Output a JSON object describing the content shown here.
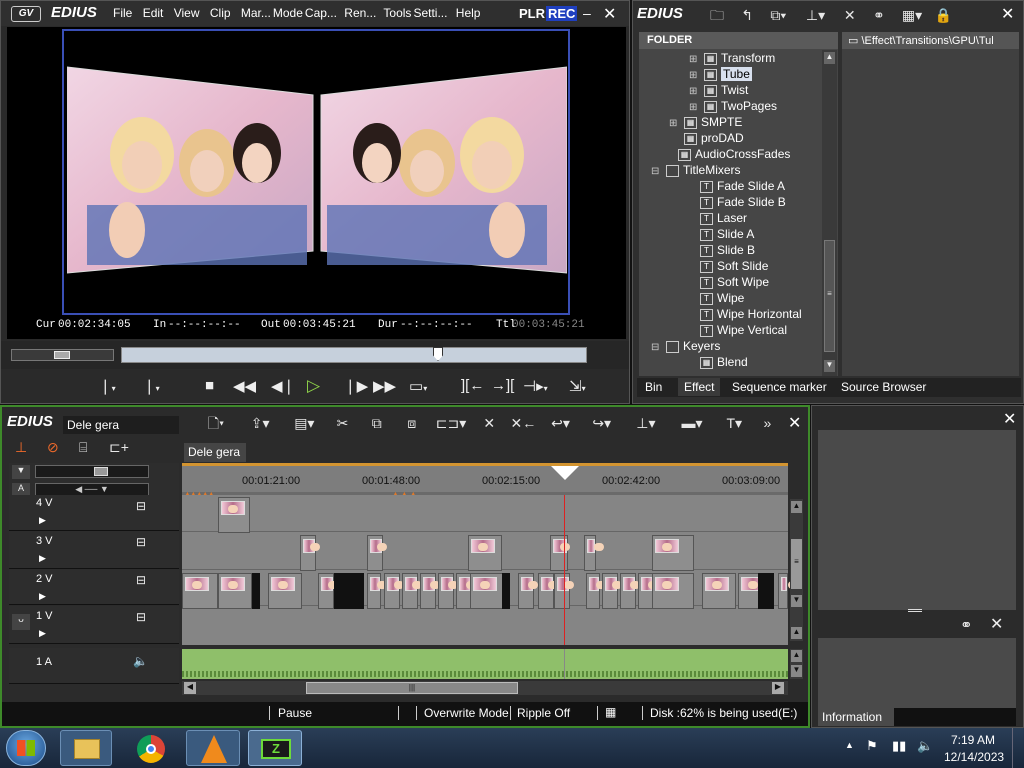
{
  "player": {
    "brand": "EDIUS",
    "menu": [
      "File",
      "Edit",
      "View",
      "Clip",
      "Mar...",
      "Mode",
      "Cap...",
      "Ren...",
      "Tools",
      "Setti...",
      "Help"
    ],
    "plr": "PLR",
    "rec": "REC",
    "cur_label": "Cur",
    "cur_value": "00:02:34:05",
    "in_label": "In",
    "in_value": "--:--:--:--",
    "out_label": "Out",
    "out_value": "00:03:45:21",
    "dur_label": "Dur",
    "dur_value": "--:--:--:--",
    "ttl_label": "Ttl",
    "ttl_value": "00:03:45:21"
  },
  "effect_panel": {
    "brand": "EDIUS",
    "folder_header": "FOLDER",
    "path": "\\Effect\\Transitions\\GPU\\Tul",
    "tree": [
      {
        "label": "Transform",
        "expand": "+"
      },
      {
        "label": "Tube",
        "expand": "+",
        "selected": true
      },
      {
        "label": "Twist",
        "expand": "+"
      },
      {
        "label": "TwoPages",
        "expand": "+"
      },
      {
        "label": "SMPTE",
        "expand": "+"
      },
      {
        "label": "proDAD",
        "expand": ""
      },
      {
        "label": "AudioCrossFades",
        "expand": ""
      },
      {
        "label": "TitleMixers",
        "expand": "−"
      },
      {
        "label": "Fade Slide A",
        "expand": ""
      },
      {
        "label": "Fade Slide B",
        "expand": ""
      },
      {
        "label": "Laser",
        "expand": ""
      },
      {
        "label": "Slide A",
        "expand": ""
      },
      {
        "label": "Slide B",
        "expand": ""
      },
      {
        "label": "Soft Slide",
        "expand": ""
      },
      {
        "label": "Soft Wipe",
        "expand": ""
      },
      {
        "label": "Wipe",
        "expand": ""
      },
      {
        "label": "Wipe Horizontal",
        "expand": ""
      },
      {
        "label": "Wipe Vertical",
        "expand": ""
      },
      {
        "label": "Keyers",
        "expand": "−"
      },
      {
        "label": "Blend",
        "expand": ""
      }
    ],
    "tabs": [
      "Bin",
      "Effect",
      "Sequence marker",
      "Source Browser"
    ]
  },
  "timeline": {
    "brand": "EDIUS",
    "project_name": "Dele gera",
    "sequence_tab": "Dele gera",
    "ruler": [
      "00:01:21:00",
      "00:01:48:00",
      "00:02:15:00",
      "00:02:42:00",
      "00:03:09:00"
    ],
    "tracks": [
      {
        "label": "4 V"
      },
      {
        "label": "3 V"
      },
      {
        "label": "2 V"
      },
      {
        "label": "1 V"
      },
      {
        "label": "1 A"
      }
    ],
    "status": {
      "pause": "Pause",
      "mode": "Overwrite Mode",
      "ripple": "Ripple Off",
      "disk": "Disk :62% is being used(E:)"
    }
  },
  "info_panel": {
    "tab": "Information"
  },
  "taskbar": {
    "time": "7:19 AM",
    "date": "12/14/2023"
  },
  "colors": {
    "accent_green": "#3d7a2b",
    "timeline_border": "#3e8a2a",
    "audio_wave": "#8fbf6a",
    "playhead": "#d22",
    "rec_blue": "#1f3fbf"
  }
}
